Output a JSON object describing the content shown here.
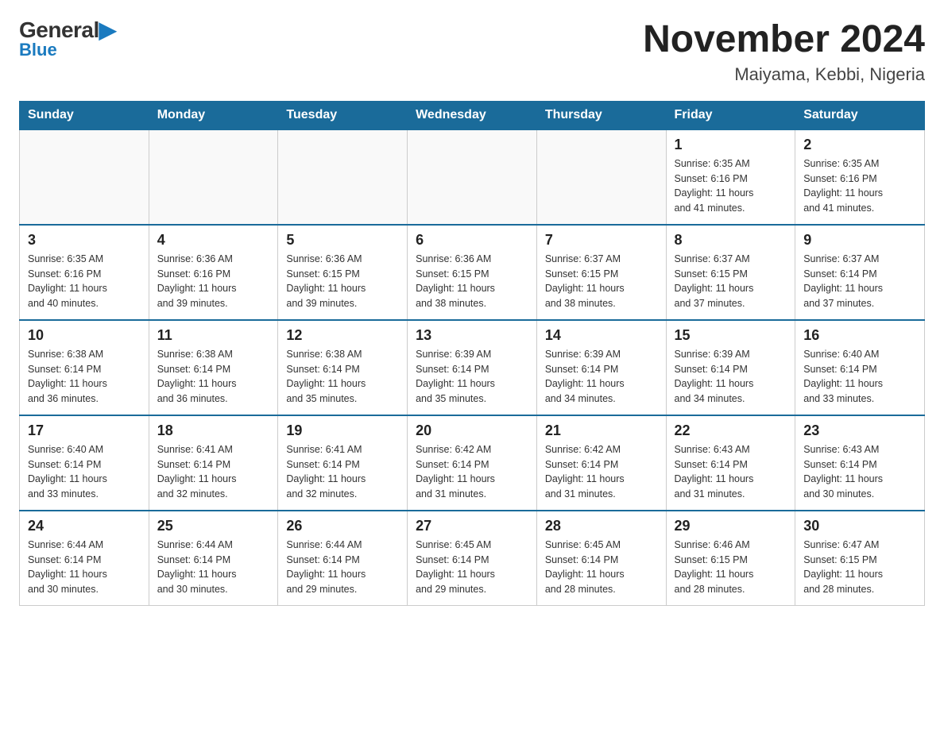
{
  "logo": {
    "general": "General",
    "blue": "Blue"
  },
  "title": "November 2024",
  "subtitle": "Maiyama, Kebbi, Nigeria",
  "days_of_week": [
    "Sunday",
    "Monday",
    "Tuesday",
    "Wednesday",
    "Thursday",
    "Friday",
    "Saturday"
  ],
  "weeks": [
    [
      {
        "day": "",
        "info": ""
      },
      {
        "day": "",
        "info": ""
      },
      {
        "day": "",
        "info": ""
      },
      {
        "day": "",
        "info": ""
      },
      {
        "day": "",
        "info": ""
      },
      {
        "day": "1",
        "info": "Sunrise: 6:35 AM\nSunset: 6:16 PM\nDaylight: 11 hours\nand 41 minutes."
      },
      {
        "day": "2",
        "info": "Sunrise: 6:35 AM\nSunset: 6:16 PM\nDaylight: 11 hours\nand 41 minutes."
      }
    ],
    [
      {
        "day": "3",
        "info": "Sunrise: 6:35 AM\nSunset: 6:16 PM\nDaylight: 11 hours\nand 40 minutes."
      },
      {
        "day": "4",
        "info": "Sunrise: 6:36 AM\nSunset: 6:16 PM\nDaylight: 11 hours\nand 39 minutes."
      },
      {
        "day": "5",
        "info": "Sunrise: 6:36 AM\nSunset: 6:15 PM\nDaylight: 11 hours\nand 39 minutes."
      },
      {
        "day": "6",
        "info": "Sunrise: 6:36 AM\nSunset: 6:15 PM\nDaylight: 11 hours\nand 38 minutes."
      },
      {
        "day": "7",
        "info": "Sunrise: 6:37 AM\nSunset: 6:15 PM\nDaylight: 11 hours\nand 38 minutes."
      },
      {
        "day": "8",
        "info": "Sunrise: 6:37 AM\nSunset: 6:15 PM\nDaylight: 11 hours\nand 37 minutes."
      },
      {
        "day": "9",
        "info": "Sunrise: 6:37 AM\nSunset: 6:14 PM\nDaylight: 11 hours\nand 37 minutes."
      }
    ],
    [
      {
        "day": "10",
        "info": "Sunrise: 6:38 AM\nSunset: 6:14 PM\nDaylight: 11 hours\nand 36 minutes."
      },
      {
        "day": "11",
        "info": "Sunrise: 6:38 AM\nSunset: 6:14 PM\nDaylight: 11 hours\nand 36 minutes."
      },
      {
        "day": "12",
        "info": "Sunrise: 6:38 AM\nSunset: 6:14 PM\nDaylight: 11 hours\nand 35 minutes."
      },
      {
        "day": "13",
        "info": "Sunrise: 6:39 AM\nSunset: 6:14 PM\nDaylight: 11 hours\nand 35 minutes."
      },
      {
        "day": "14",
        "info": "Sunrise: 6:39 AM\nSunset: 6:14 PM\nDaylight: 11 hours\nand 34 minutes."
      },
      {
        "day": "15",
        "info": "Sunrise: 6:39 AM\nSunset: 6:14 PM\nDaylight: 11 hours\nand 34 minutes."
      },
      {
        "day": "16",
        "info": "Sunrise: 6:40 AM\nSunset: 6:14 PM\nDaylight: 11 hours\nand 33 minutes."
      }
    ],
    [
      {
        "day": "17",
        "info": "Sunrise: 6:40 AM\nSunset: 6:14 PM\nDaylight: 11 hours\nand 33 minutes."
      },
      {
        "day": "18",
        "info": "Sunrise: 6:41 AM\nSunset: 6:14 PM\nDaylight: 11 hours\nand 32 minutes."
      },
      {
        "day": "19",
        "info": "Sunrise: 6:41 AM\nSunset: 6:14 PM\nDaylight: 11 hours\nand 32 minutes."
      },
      {
        "day": "20",
        "info": "Sunrise: 6:42 AM\nSunset: 6:14 PM\nDaylight: 11 hours\nand 31 minutes."
      },
      {
        "day": "21",
        "info": "Sunrise: 6:42 AM\nSunset: 6:14 PM\nDaylight: 11 hours\nand 31 minutes."
      },
      {
        "day": "22",
        "info": "Sunrise: 6:43 AM\nSunset: 6:14 PM\nDaylight: 11 hours\nand 31 minutes."
      },
      {
        "day": "23",
        "info": "Sunrise: 6:43 AM\nSunset: 6:14 PM\nDaylight: 11 hours\nand 30 minutes."
      }
    ],
    [
      {
        "day": "24",
        "info": "Sunrise: 6:44 AM\nSunset: 6:14 PM\nDaylight: 11 hours\nand 30 minutes."
      },
      {
        "day": "25",
        "info": "Sunrise: 6:44 AM\nSunset: 6:14 PM\nDaylight: 11 hours\nand 30 minutes."
      },
      {
        "day": "26",
        "info": "Sunrise: 6:44 AM\nSunset: 6:14 PM\nDaylight: 11 hours\nand 29 minutes."
      },
      {
        "day": "27",
        "info": "Sunrise: 6:45 AM\nSunset: 6:14 PM\nDaylight: 11 hours\nand 29 minutes."
      },
      {
        "day": "28",
        "info": "Sunrise: 6:45 AM\nSunset: 6:14 PM\nDaylight: 11 hours\nand 28 minutes."
      },
      {
        "day": "29",
        "info": "Sunrise: 6:46 AM\nSunset: 6:15 PM\nDaylight: 11 hours\nand 28 minutes."
      },
      {
        "day": "30",
        "info": "Sunrise: 6:47 AM\nSunset: 6:15 PM\nDaylight: 11 hours\nand 28 minutes."
      }
    ]
  ]
}
